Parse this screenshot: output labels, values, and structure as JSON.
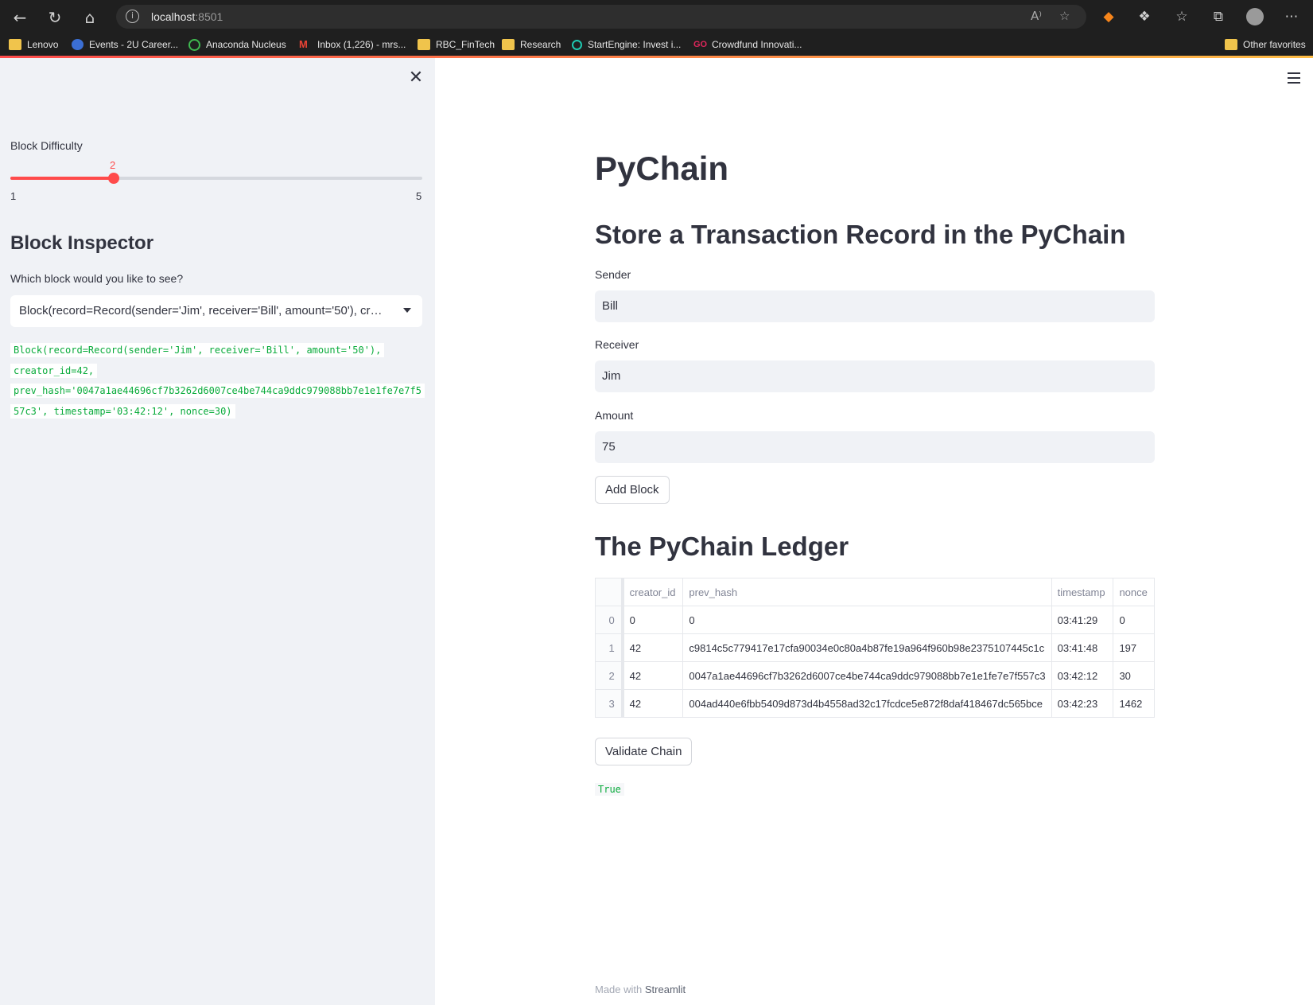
{
  "browser": {
    "url_host": "localhost",
    "url_port": ":8501",
    "bookmarks": [
      {
        "label": "Lenovo",
        "color": "#f0c44c"
      },
      {
        "label": "Events - 2U Career...",
        "color": "#3b6fd4"
      },
      {
        "label": "Anaconda Nucleus",
        "color": "#3fb950"
      },
      {
        "label": "Inbox (1,226) - mrs...",
        "color": "#ea4335"
      },
      {
        "label": "RBC_FinTech",
        "color": "#f0c44c"
      },
      {
        "label": "Research",
        "color": "#f0c44c"
      },
      {
        "label": "StartEngine: Invest i...",
        "color": "#1fc8b0"
      },
      {
        "label": "Crowdfund Innovati...",
        "color": "#e0265c"
      }
    ],
    "other_favorites": "Other favorites"
  },
  "sidebar": {
    "slider_label": "Block Difficulty",
    "slider_value": "2",
    "slider_min": "1",
    "slider_max": "5",
    "slider_fraction": 0.25,
    "inspector_title": "Block Inspector",
    "select_label": "Which block would you like to see?",
    "select_value": "Block(record=Record(sender='Jim', receiver='Bill', amount='50'), creator_id=42, prev_hash='0047a1ae44696cf7b3262d6007ce4be744ca9ddc979088bb7e1e1fe7e7f557c3', timestamp='03:42:12', nonce=30)",
    "code_lines": [
      "Block(record=Record(sender='Jim', receiver='Bill', amount='50'),",
      "creator_id=42,",
      "prev_hash='0047a1ae44696cf7b3262d6007ce4be744ca9ddc979088bb7e1e1fe7e7f5",
      "57c3', timestamp='03:42:12', nonce=30)"
    ]
  },
  "main": {
    "title": "PyChain",
    "store_heading": "Store a Transaction Record in the PyChain",
    "sender_label": "Sender",
    "sender_value": "Bill",
    "receiver_label": "Receiver",
    "receiver_value": "Jim",
    "amount_label": "Amount",
    "amount_value": "75",
    "add_block_label": "Add Block",
    "ledger_heading": "The PyChain Ledger",
    "table": {
      "columns": [
        "",
        "creator_id",
        "prev_hash",
        "timestamp",
        "nonce"
      ],
      "rows": [
        [
          "0",
          "0",
          "0",
          "03:41:29",
          "0"
        ],
        [
          "1",
          "42",
          "c9814c5c779417e17cfa90034e0c80a4b87fe19a964f960b98e2375107445c1c",
          "03:41:48",
          "197"
        ],
        [
          "2",
          "42",
          "0047a1ae44696cf7b3262d6007ce4be744ca9ddc979088bb7e1e1fe7e7f557c3",
          "03:42:12",
          "30"
        ],
        [
          "3",
          "42",
          "004ad440e6fbb5409d873d4b4558ad32c17fcdce5e872f8daf418467dc565bce",
          "03:42:23",
          "1462"
        ]
      ]
    },
    "validate_label": "Validate Chain",
    "validate_result": "True",
    "footer_prefix": "Made with ",
    "footer_brand": "Streamlit"
  }
}
